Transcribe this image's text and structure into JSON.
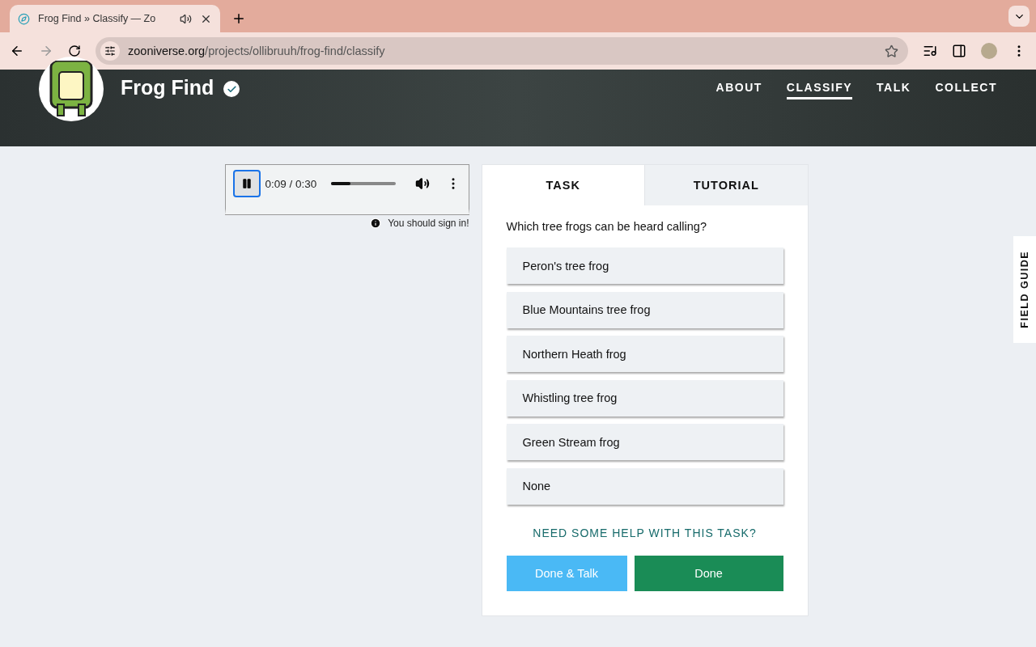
{
  "browser": {
    "tab_title": "Frog Find » Classify — Zo",
    "url_host": "zooniverse.org",
    "url_path": "/projects/ollibruuh/frog-find/classify"
  },
  "project": {
    "title": "Frog Find",
    "nav": [
      {
        "label": "ABOUT",
        "selected": false
      },
      {
        "label": "CLASSIFY",
        "selected": true
      },
      {
        "label": "TALK",
        "selected": false
      },
      {
        "label": "COLLECT",
        "selected": false
      }
    ]
  },
  "player": {
    "time": "0:09 / 0:30",
    "level": 0.3,
    "playing": true,
    "notice": "You should sign in!"
  },
  "task_tabs": [
    {
      "label": "TASK",
      "selected": true
    },
    {
      "label": "TUTORIAL",
      "selected": false
    }
  ],
  "question": "Which tree frogs can be heard calling?",
  "answers": [
    "Peron's tree frog",
    "Blue Mountains tree frog",
    "Northern Heath frog",
    "Whistling tree frog",
    "Green Stream frog",
    "None"
  ],
  "help_link": "NEED SOME HELP WITH THIS TASK?",
  "buttons": [
    {
      "label": "Done & Talk",
      "kind": "talk"
    },
    {
      "label": "Done",
      "kind": "done"
    }
  ],
  "field_guide": "FIELD GUIDE"
}
